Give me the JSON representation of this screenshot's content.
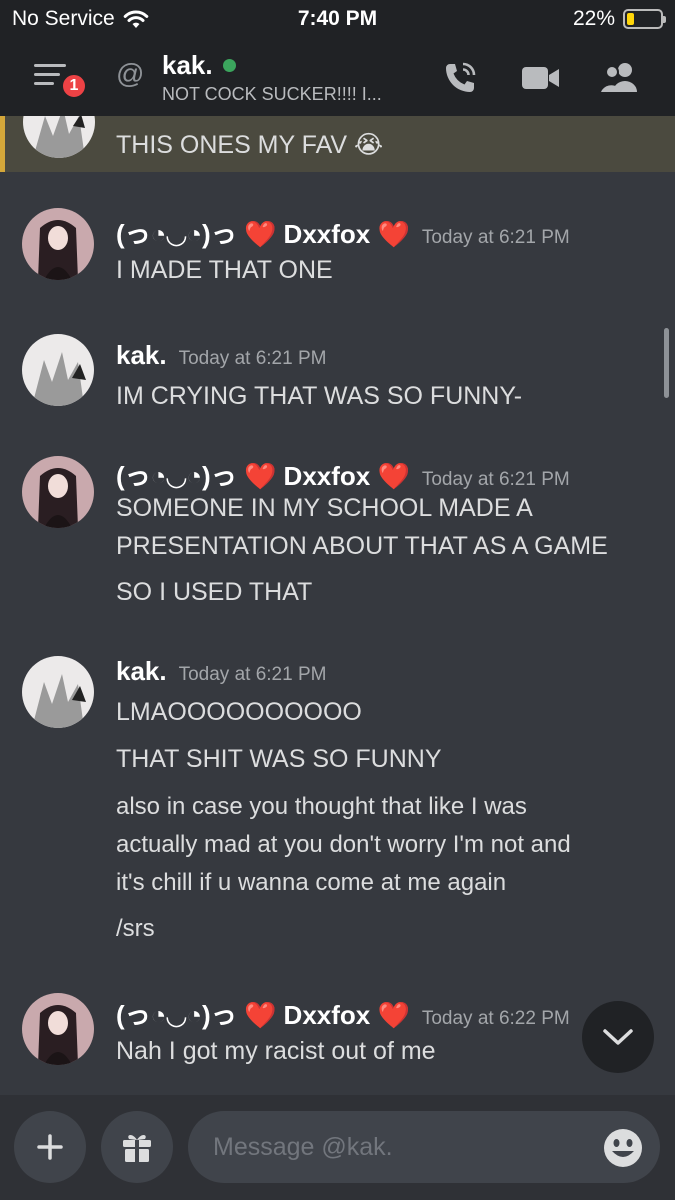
{
  "status_bar": {
    "carrier": "No Service",
    "time": "7:40 PM",
    "battery": "22%",
    "battery_level": 0.22
  },
  "header": {
    "notification_count": "1",
    "channel_name": "kak.",
    "custom_status": "NOT COCK SUCKER!!!! I...",
    "icons": [
      "menu-icon",
      "at-icon",
      "call-icon",
      "video-icon",
      "members-icon"
    ]
  },
  "highlighted_message": {
    "text": "THIS ONES MY FAV 😭"
  },
  "messages": [
    {
      "author": "(っ◔◡◔)っ ❤️ Dxxfox ❤️",
      "timestamp": "Today at 6:21 PM",
      "lines": [
        "I MADE THAT ONE"
      ]
    },
    {
      "author": "kak.",
      "timestamp": "Today at 6:21 PM",
      "lines": [
        "IM CRYING THAT WAS SO FUNNY-"
      ]
    },
    {
      "author": "(っ◔◡◔)っ ❤️ Dxxfox ❤️",
      "timestamp": "Today at 6:21 PM",
      "lines": [
        "SOMEONE IN MY SCHOOL MADE A",
        "PRESENTATION ABOUT THAT AS A GAME",
        "SO I USED THAT"
      ]
    },
    {
      "author": "kak.",
      "timestamp": "Today at 6:21 PM",
      "lines": [
        "LMAOOOOOOOOOO",
        "THAT SHIT WAS SO FUNNY",
        "also in case you thought that like I was",
        "actually mad at you don't worry I'm not and",
        "it's chill if u wanna come at me again",
        "/srs"
      ]
    },
    {
      "author": "(っ◔◡◔)っ ❤️ Dxxfox ❤️",
      "timestamp": "Today at 6:22 PM",
      "lines": [
        "Nah I got my racist out of me"
      ]
    }
  ],
  "composer": {
    "placeholder": "Message @kak."
  }
}
